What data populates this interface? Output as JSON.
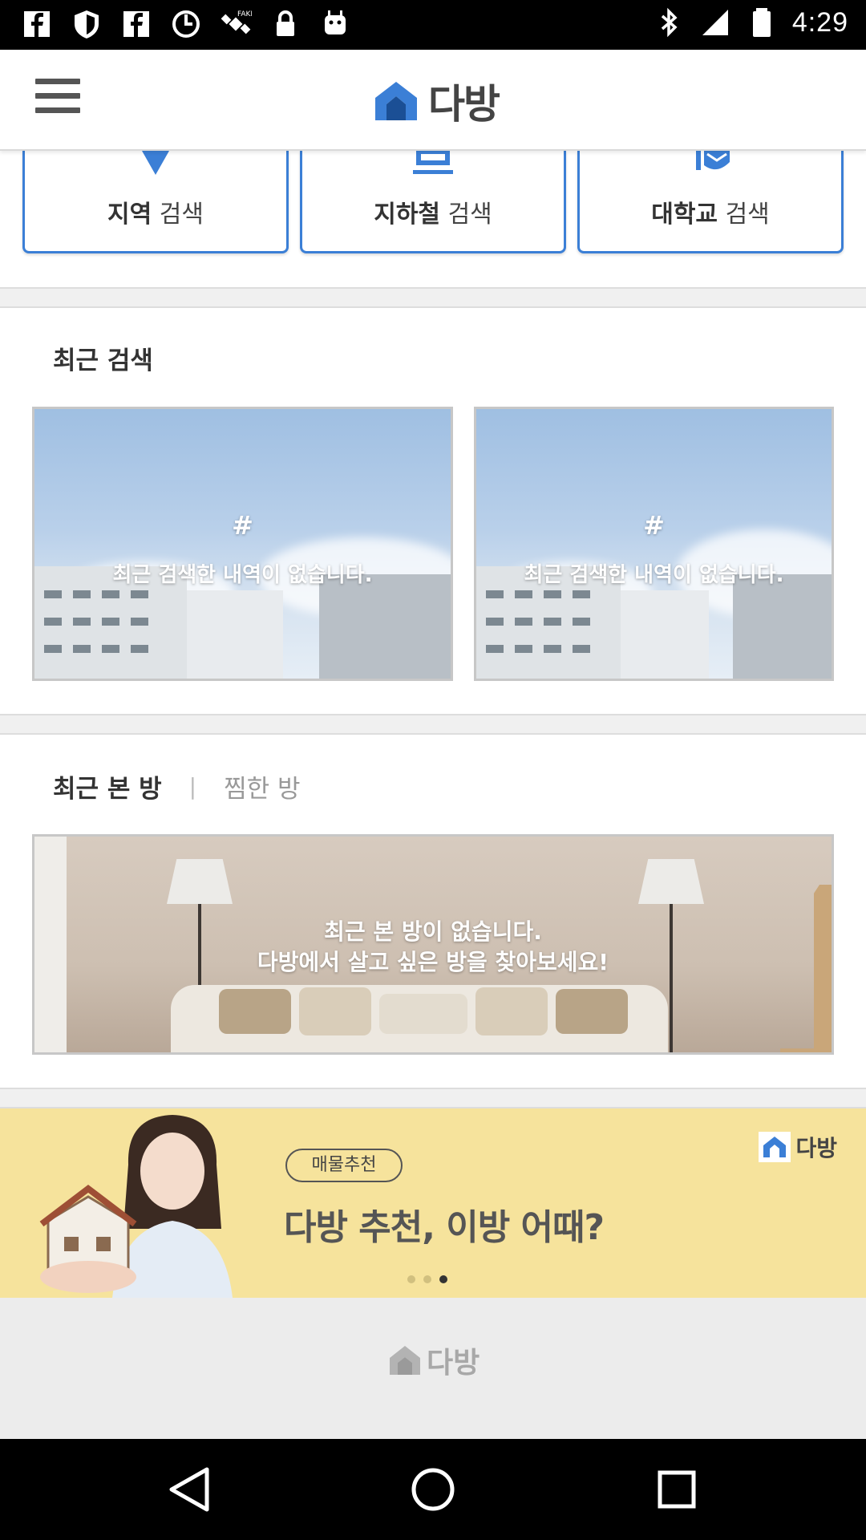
{
  "status_bar": {
    "time": "4:29",
    "left_icons": [
      "facebook-icon",
      "shield-icon",
      "facebook-icon",
      "sync-icon",
      "satellite-icon",
      "lock-icon",
      "android-icon"
    ],
    "right_icons": [
      "bluetooth-icon",
      "signal-icon",
      "battery-icon"
    ]
  },
  "app": {
    "name": "다방",
    "menu_icon": "hamburger-menu-icon",
    "brand_color": "#3b7fd6"
  },
  "search_buttons": [
    {
      "bold": "지역",
      "rest": " 검색",
      "icon": "map-pin-icon"
    },
    {
      "bold": "지하철",
      "rest": " 검색",
      "icon": "subway-icon"
    },
    {
      "bold": "대학교",
      "rest": " 검색",
      "icon": "graduation-cap-icon"
    }
  ],
  "recent_search": {
    "title": "최근 검색",
    "cards": [
      {
        "hash": "#",
        "message": "최근 검색한 내역이 없습니다."
      },
      {
        "hash": "#",
        "message": "최근 검색한 내역이 없습니다."
      }
    ]
  },
  "recent_rooms": {
    "tab_active": "최근 본 방",
    "tab_separator": "|",
    "tab_inactive": "찜한 방",
    "empty_line1": "최근 본 방이 없습니다.",
    "empty_line2": "다방에서 살고 싶은 방을 찾아보세요!"
  },
  "banner": {
    "pill": "매물추천",
    "headline": "다방 추천, 이방 어때?",
    "logo": "다방",
    "page_index": 3,
    "page_count": 3
  },
  "footer": {
    "logo": "다방"
  },
  "nav": [
    "back-icon",
    "home-icon",
    "recents-icon"
  ]
}
